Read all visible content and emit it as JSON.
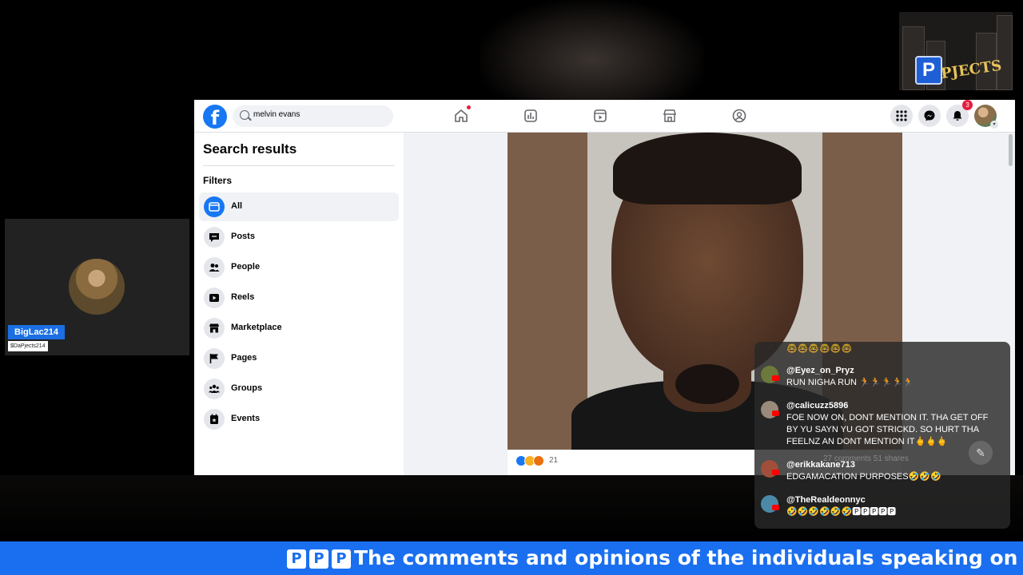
{
  "stream": {
    "logo_text": "PJECTS",
    "logo_letter": "P",
    "ticker_prefix": [
      "P",
      "P",
      "P"
    ],
    "ticker_text": "The comments and opinions of the individuals speaking on this replay"
  },
  "cam": {
    "name": "BigLac214",
    "handle": "$DaPjects214"
  },
  "facebook": {
    "search_value": "melvin evans",
    "notifications_count": "3",
    "nav_icons": [
      "home-icon",
      "stats-icon",
      "video-icon",
      "marketplace-icon",
      "groups-icon"
    ],
    "sidebar": {
      "title": "Search results",
      "filters_label": "Filters",
      "items": [
        {
          "label": "All",
          "icon": "all-icon"
        },
        {
          "label": "Posts",
          "icon": "posts-icon"
        },
        {
          "label": "People",
          "icon": "people-icon"
        },
        {
          "label": "Reels",
          "icon": "reels-icon"
        },
        {
          "label": "Marketplace",
          "icon": "marketplace-icon"
        },
        {
          "label": "Pages",
          "icon": "flag-icon"
        },
        {
          "label": "Groups",
          "icon": "groups-icon"
        },
        {
          "label": "Events",
          "icon": "calendar-icon"
        }
      ]
    },
    "post": {
      "reaction_count": "21",
      "comments_shares": "27 comments  51 shares"
    }
  },
  "chat": {
    "top_emoji": "🤓🤓🤓🤓🤓🤓",
    "messages": [
      {
        "user": "@Eyez_on_Pryz",
        "text": "RUN NIGHA RUN 🏃🏃🏃🏃🏃",
        "avatar_color": "#6b7a3a"
      },
      {
        "user": "@calicuzz5896",
        "text": "FOE NOW ON, DONT MENTION IT. THA GET OFF BY YU SAYN YU GOT STRICKD. SO HURT THA FEELNZ AN DONT MENTION IT🖕🖕🖕",
        "avatar_color": "#9a8a7a"
      },
      {
        "user": "@erikkakane713",
        "text": "EDGAMACATION PURPOSES🤣🤣🤣",
        "avatar_color": "#a0503a"
      },
      {
        "user": "@TheRealdeonnyc",
        "text": "🤣🤣🤣🤣🤣🤣🅿🅿🅿🅿🅿",
        "avatar_color": "#4a8aa8"
      }
    ]
  },
  "colors": {
    "facebook_blue": "#1877f2",
    "ticker_blue": "#1a6ff0",
    "cam_tag_blue": "#1b6fe3"
  }
}
